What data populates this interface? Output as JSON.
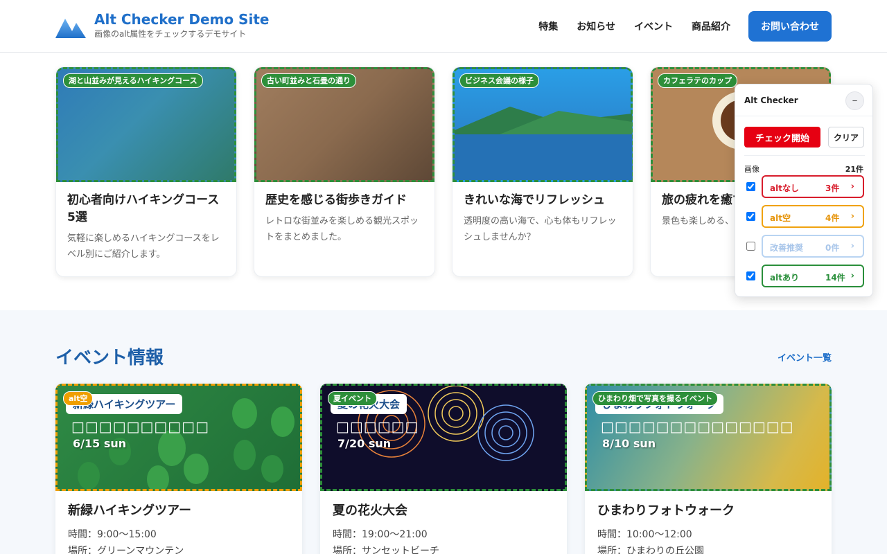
{
  "header": {
    "title": "Alt Checker Demo Site",
    "subtitle": "画像のalt属性をチェックするデモサイト",
    "nav": [
      "特集",
      "お知らせ",
      "イベント",
      "商品紹介"
    ],
    "contact_label": "お問い合わせ"
  },
  "cards": [
    {
      "alt": "湖と山並みが見えるハイキングコース",
      "title": "初心者向けハイキングコース5選",
      "desc": "気軽に楽しめるハイキングコースをレベル別にご紹介します。"
    },
    {
      "alt": "古い町並みと石畳の通り",
      "title": "歴史を感じる街歩きガイド",
      "desc": "レトロな街並みを楽しめる観光スポットをまとめました。"
    },
    {
      "alt": "ビジネス会議の様子",
      "title": "きれいな海でリフレッシュ",
      "desc": "透明度の高い海で、心も体もリフレッシュしませんか？"
    },
    {
      "alt": "カフェラテのカップ",
      "title": "旅の疲れを癒す",
      "desc": "景色も楽しめる、ピックアップし"
    }
  ],
  "events": {
    "title": "イベント情報",
    "more": "イベント一覧",
    "items": [
      {
        "tag": "alt空",
        "banner": "新緑ハイキングツアー",
        "blocks": "□□□□□□□□□□",
        "date": "6/15 sun",
        "title": "新緑ハイキングツアー",
        "time": "時間：9:00〜15:00",
        "place": "場所：グリーンマウンテン"
      },
      {
        "tag": "夏イベント",
        "banner": "夏の花火大会",
        "blocks": "□□□□□□",
        "date": "7/20 sun",
        "title": "夏の花火大会",
        "time": "時間：19:00〜21:00",
        "place": "場所：サンセットビーチ"
      },
      {
        "tag": "ひまわり畑で写真を撮るイベント",
        "banner": "ひまわりフォトウォーク",
        "blocks": "□□□□□□□□□□□□□□",
        "date": "8/10 sun",
        "title": "ひまわりフォトウォーク",
        "time": "時間：10:00〜12:00",
        "place": "場所：ひまわりの丘公園"
      }
    ]
  },
  "panel": {
    "title": "Alt Checker",
    "minimize": "−",
    "start": "チェック開始",
    "clear": "クリア",
    "images_label": "画像",
    "images_count": "21件",
    "rows": [
      {
        "label": "altなし",
        "count": "3件",
        "arrow": "›",
        "checked": true
      },
      {
        "label": "alt空",
        "count": "4件",
        "arrow": "›",
        "checked": true
      },
      {
        "label": "改善推奨",
        "count": "0件",
        "arrow": "›",
        "checked": false
      },
      {
        "label": "altあり",
        "count": "14件",
        "arrow": "›",
        "checked": true
      }
    ]
  }
}
